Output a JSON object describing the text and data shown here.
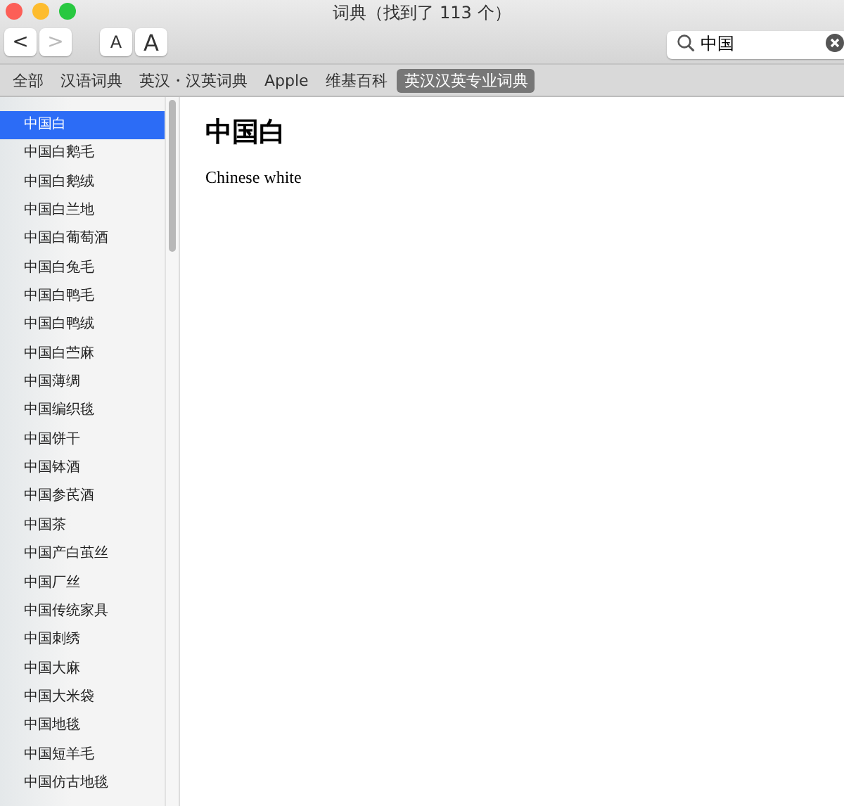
{
  "window": {
    "title": "词典（找到了 113 个）"
  },
  "toolbar": {
    "back": {
      "label": "<",
      "disabled": false
    },
    "forward": {
      "label": ">",
      "disabled": true
    },
    "font_smaller": "A",
    "font_larger": "A",
    "search": {
      "value": "中国"
    }
  },
  "tabs": [
    {
      "label": "全部",
      "selected": false
    },
    {
      "label": "汉语词典",
      "selected": false
    },
    {
      "label": "英汉・汉英词典",
      "selected": false
    },
    {
      "label": "Apple",
      "selected": false
    },
    {
      "label": "维基百科",
      "selected": false
    },
    {
      "label": "英汉汉英专业词典",
      "selected": true
    }
  ],
  "sidebar": {
    "items": [
      {
        "label": "中国白",
        "selected": true
      },
      {
        "label": "中国白鹅毛",
        "selected": false
      },
      {
        "label": "中国白鹅绒",
        "selected": false
      },
      {
        "label": "中国白兰地",
        "selected": false
      },
      {
        "label": "中国白葡萄酒",
        "selected": false
      },
      {
        "label": "中国白兔毛",
        "selected": false
      },
      {
        "label": "中国白鸭毛",
        "selected": false
      },
      {
        "label": "中国白鸭绒",
        "selected": false
      },
      {
        "label": "中国白苎麻",
        "selected": false
      },
      {
        "label": "中国薄绸",
        "selected": false
      },
      {
        "label": "中国编织毯",
        "selected": false
      },
      {
        "label": "中国饼干",
        "selected": false
      },
      {
        "label": "中国钵酒",
        "selected": false
      },
      {
        "label": "中国参芪酒",
        "selected": false
      },
      {
        "label": "中国茶",
        "selected": false
      },
      {
        "label": "中国产白茧丝",
        "selected": false
      },
      {
        "label": "中国厂丝",
        "selected": false
      },
      {
        "label": "中国传统家具",
        "selected": false
      },
      {
        "label": "中国刺绣",
        "selected": false
      },
      {
        "label": "中国大麻",
        "selected": false
      },
      {
        "label": "中国大米袋",
        "selected": false
      },
      {
        "label": "中国地毯",
        "selected": false
      },
      {
        "label": "中国短羊毛",
        "selected": false
      },
      {
        "label": "中国仿古地毯",
        "selected": false
      }
    ]
  },
  "entry": {
    "headword": "中国白",
    "definition": "Chinese white"
  }
}
